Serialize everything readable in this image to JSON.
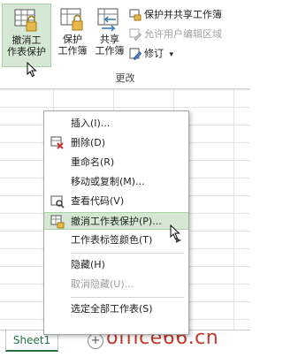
{
  "ribbon": {
    "buttons": [
      {
        "line1": "撤消工",
        "line2": "作表保护"
      },
      {
        "line1": "保护",
        "line2": "工作簿"
      },
      {
        "line1": "共享",
        "line2": "工作簿"
      }
    ],
    "small_items": [
      {
        "label": "保护并共享工作簿",
        "disabled": false
      },
      {
        "label": "允许用户编辑区域",
        "disabled": true
      },
      {
        "label": "修订",
        "disabled": false
      }
    ],
    "dropdown_glyph": "▾",
    "group_label": "更改"
  },
  "context_menu": {
    "items": [
      {
        "label": "插入(I)..."
      },
      {
        "label": "删除(D)"
      },
      {
        "label": "重命名(R)"
      },
      {
        "label": "移动或复制(M)..."
      },
      {
        "label": "查看代码(V)"
      },
      {
        "label": "撤消工作表保护(P)..."
      },
      {
        "label": "工作表标签颜色(T)"
      },
      {
        "label": "隐藏(H)"
      },
      {
        "label": "取消隐藏(U)..."
      },
      {
        "label": "选定全部工作表(S)"
      }
    ],
    "submenu_arrow": "▶"
  },
  "tabs": {
    "sheet_name": "Sheet1",
    "add_sheet_glyph": "+"
  },
  "watermark": "office66.cn",
  "colors": {
    "highlight": "#d5e8d4",
    "excel_green": "#217346",
    "watermark": "#c0392b"
  }
}
